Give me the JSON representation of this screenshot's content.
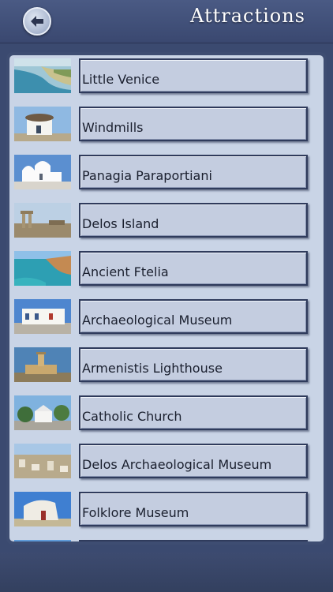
{
  "header": {
    "title": "Attractions",
    "back_icon": "back-arrow-icon"
  },
  "attractions": [
    {
      "label": "Little Venice"
    },
    {
      "label": "Windmills"
    },
    {
      "label": "Panagia Paraportiani"
    },
    {
      "label": "Delos Island"
    },
    {
      "label": "Ancient Ftelia"
    },
    {
      "label": "Archaeological Museum"
    },
    {
      "label": "Armenistis Lighthouse"
    },
    {
      "label": "Catholic Church"
    },
    {
      "label": "Delos Archaeological Museum"
    },
    {
      "label": "Folklore Museum"
    },
    {
      "label": ""
    }
  ]
}
